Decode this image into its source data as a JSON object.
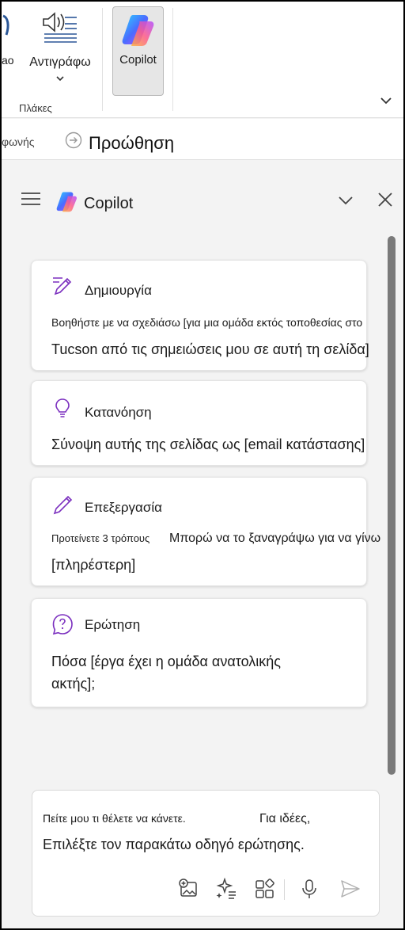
{
  "ribbon": {
    "partial_label": "ao",
    "dictate_label": "Αντιγράφω",
    "group_label": "Πλάκες",
    "copilot_label": "Copilot"
  },
  "toolbar2": {
    "partial_text": "φωνής",
    "title": "Προώθηση"
  },
  "pane": {
    "title": "Copilot",
    "cards": [
      {
        "icon": "pen-sparkle-icon",
        "title": "Δημιουργία",
        "line1": "Βοηθήστε με να σχεδιάσω [για μια ομάδα εκτός τοποθεσίας στο",
        "line2": "Tucson από τις σημειώσεις μου σε αυτή τη σελίδα]"
      },
      {
        "icon": "lightbulb-icon",
        "title": "Κατανόηση",
        "line1": "Σύνοψη αυτής της σελίδας ως [email κατάστασης]"
      },
      {
        "icon": "pencil-icon",
        "title": "Επεξεργασία",
        "line1a": "Προτείνετε 3 τρόπους",
        "line1b": "Μπορώ να το ξαναγράψω για να γίνω",
        "line2": "[πληρέστερη]"
      },
      {
        "icon": "question-bubble-icon",
        "title": "Ερώτηση",
        "line1": "Πόσα [έργα έχει η ομάδα ανατολικής",
        "line2": "ακτής];"
      }
    ],
    "input": {
      "line1a": "Πείτε μου τι θέλετε να κάνετε.",
      "line1b": "Για ιδέες,",
      "line2": "Επιλέξτε τον παρακάτω οδηγό ερώτησης."
    }
  },
  "colors": {
    "accent": "#7b2fbf",
    "pane_bg": "#f3f3f3",
    "scrollbar": "#7a7a7a"
  }
}
